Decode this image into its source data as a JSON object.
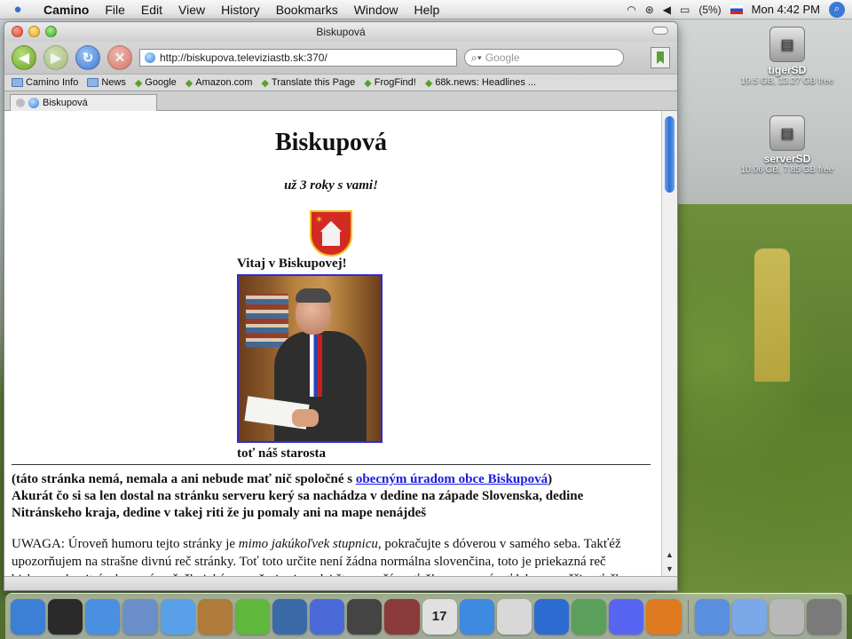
{
  "menubar": {
    "app": "Camino",
    "items": [
      "File",
      "Edit",
      "View",
      "History",
      "Bookmarks",
      "Window",
      "Help"
    ],
    "battery": "(5%)",
    "clock": "Mon 4:42 PM"
  },
  "window": {
    "title": "Biskupová",
    "url": "http://biskupova.televiziastb.sk:370/",
    "search_placeholder": "Google",
    "bookmarks": [
      {
        "label": "Camino Info",
        "icon": "folder"
      },
      {
        "label": "News",
        "icon": "folder"
      },
      {
        "label": "Google",
        "icon": "link"
      },
      {
        "label": "Amazon.com",
        "icon": "link"
      },
      {
        "label": "Translate this Page",
        "icon": "link"
      },
      {
        "label": "FrogFind!",
        "icon": "link"
      },
      {
        "label": "68k.news: Headlines ...",
        "icon": "link"
      }
    ],
    "tab_label": "Biskupová"
  },
  "page": {
    "heading": "Biskupová",
    "tagline": "už 3 roky s vami!",
    "welcome": "Vitaj v Biskupovej!",
    "caption": "toť náš starosta",
    "notice_pre": "(táto stránka nemá, nemala a ani nebude mať nič spoločné s ",
    "notice_link": "obecným úradom obce Biskupová",
    "notice_post": ")",
    "notice_line2": "Akurát čo si sa len dostal na stránku serveru kerý sa nachádza v dedine na západe Slovenska, dedine Nitránskeho kraja, dedine v takej riti že ju pomaly ani na mape nenájdeš",
    "uwaga_pre": "UWAGA: Úroveň humoru tejto stránky je ",
    "uwaga_em": "mimo jakúkoľvek stupnicu",
    "uwaga_post": ", pokračujte s dóverou v samého seba. Takťéž upozorňujem na strašne divnú reč stránky. Toť toto určite není žádna normálna slovenčina, toto je priekazná reč biskupovskonitránskonovúmočačkoická s semňu je si medzi štyrma očáma ťažko sa vyznávať lebo povečšine ťeško"
  },
  "desktop": {
    "drives": [
      {
        "name": "tigerSD",
        "info": "19.5 GB, 13.27 GB free"
      },
      {
        "name": "serverSD",
        "info": "10.06 GB, 7.85 GB free"
      }
    ]
  },
  "dock": {
    "calendar_day": "17",
    "apps": [
      {
        "name": "finder-icon",
        "color": "#3b7fd6"
      },
      {
        "name": "dashboard-icon",
        "color": "#2a2a2a"
      },
      {
        "name": "safari-icon",
        "color": "#4a90e0"
      },
      {
        "name": "mail-icon",
        "color": "#6a8fc8"
      },
      {
        "name": "ichat-icon",
        "color": "#5aa0e8"
      },
      {
        "name": "address-book-icon",
        "color": "#b07a3a"
      },
      {
        "name": "itunes-icon",
        "color": "#5fb83c"
      },
      {
        "name": "iphoto-icon",
        "color": "#3a6aa8"
      },
      {
        "name": "imovie-icon",
        "color": "#4a6ad8"
      },
      {
        "name": "garageband-icon",
        "color": "#444444"
      },
      {
        "name": "photo-booth-icon",
        "color": "#8a3a3a"
      },
      {
        "name": "ical-icon",
        "color": "#e0e0e0"
      },
      {
        "name": "quicktime-icon",
        "color": "#3d8ae0"
      },
      {
        "name": "preview-icon",
        "color": "#d8d8d8"
      },
      {
        "name": "network-icon",
        "color": "#2c6cd0"
      },
      {
        "name": "camino-icon",
        "color": "#5aa05a"
      },
      {
        "name": "discord-icon",
        "color": "#5865f2"
      },
      {
        "name": "firefox-icon",
        "color": "#e07a20"
      },
      {
        "name": "applications-folder-icon",
        "color": "#5a8fe0"
      },
      {
        "name": "documents-folder-icon",
        "color": "#7aa8e8"
      },
      {
        "name": "mail-drop-icon",
        "color": "#b8b8b8"
      },
      {
        "name": "trash-icon",
        "color": "#7a7a7a"
      }
    ]
  }
}
